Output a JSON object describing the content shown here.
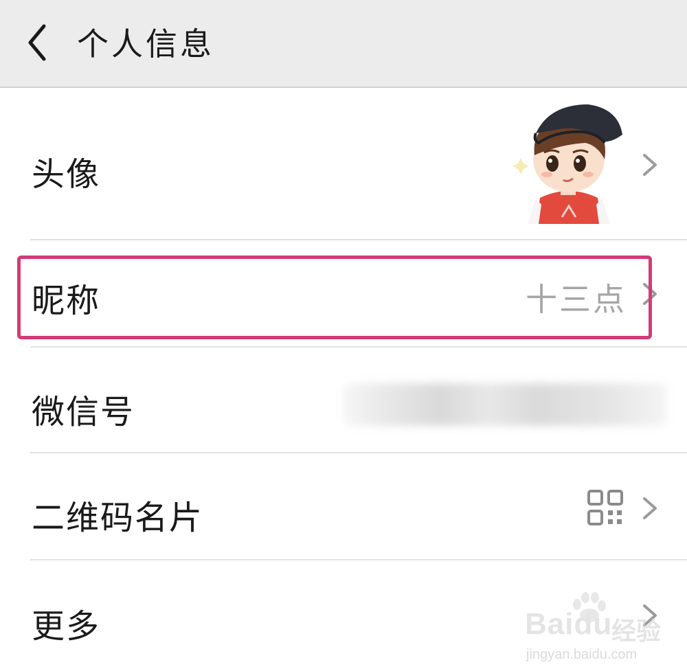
{
  "header": {
    "title": "个人信息"
  },
  "rows": [
    {
      "label": "头像"
    },
    {
      "label": "昵称",
      "value": "十三点"
    },
    {
      "label": "微信号"
    },
    {
      "label": "二维码名片"
    },
    {
      "label": "更多"
    }
  ],
  "watermark": {
    "logo": "Baidu",
    "cn": "经验",
    "url": "jingyan.baidu.com"
  },
  "colors": {
    "highlight": "#d43a77",
    "header_bg": "#ececec",
    "value_text": "#a6a6a6"
  },
  "icons": [
    "back-arrow-icon",
    "chevron-right-icon",
    "qr-code-icon"
  ]
}
